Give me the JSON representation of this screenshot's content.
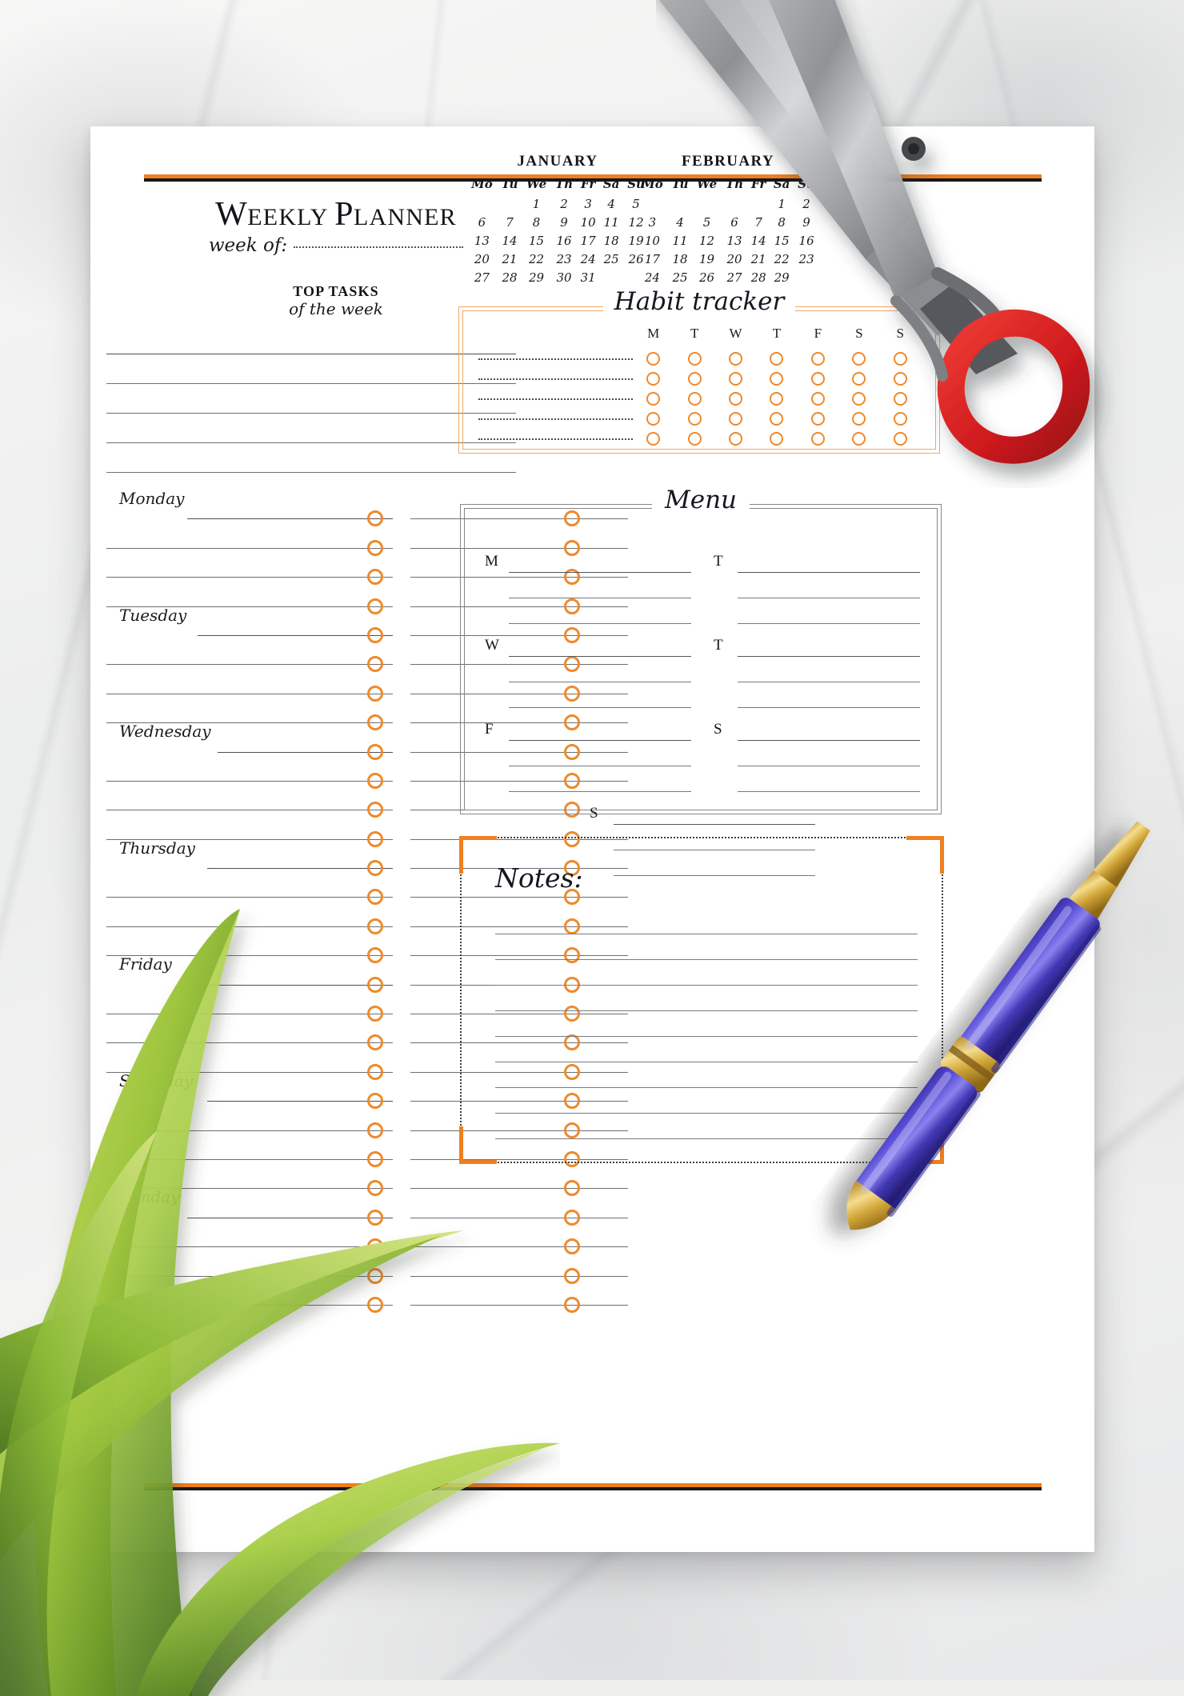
{
  "page": {
    "title_part1": "W",
    "title_part2": "EEKLY ",
    "title_part3": "P",
    "title_part4": "LANNER",
    "title_full": "Weekly Planner",
    "week_of_label": "week of:",
    "accent_orange": "#EF7F1F",
    "circle_orange": "#EE8A2C",
    "rule_black": "#19181A",
    "habit_border": "#F0A867"
  },
  "calendars": [
    {
      "name": "JANUARY",
      "weekday_headers": [
        "Mo",
        "Tu",
        "We",
        "Th",
        "Fr",
        "Sa",
        "Su"
      ],
      "weeks": [
        [
          "",
          "",
          "1",
          "2",
          "3",
          "4",
          "5"
        ],
        [
          "6",
          "7",
          "8",
          "9",
          "10",
          "11",
          "12"
        ],
        [
          "13",
          "14",
          "15",
          "16",
          "17",
          "18",
          "19"
        ],
        [
          "20",
          "21",
          "22",
          "23",
          "24",
          "25",
          "26"
        ],
        [
          "27",
          "28",
          "29",
          "30",
          "31",
          "",
          ""
        ]
      ]
    },
    {
      "name": "FEBRUARY",
      "weekday_headers": [
        "Mo",
        "Tu",
        "We",
        "Th",
        "Fr",
        "Sa",
        "Su"
      ],
      "weeks": [
        [
          "",
          "",
          "",
          "",
          "",
          "1",
          "2"
        ],
        [
          "3",
          "4",
          "5",
          "6",
          "7",
          "8",
          "9"
        ],
        [
          "10",
          "11",
          "12",
          "13",
          "14",
          "15",
          "16"
        ],
        [
          "17",
          "18",
          "19",
          "20",
          "21",
          "22",
          "23"
        ],
        [
          "24",
          "25",
          "26",
          "27",
          "28",
          "29",
          ""
        ]
      ]
    }
  ],
  "top_tasks": {
    "heading_line1": "TOP TASKS",
    "heading_line2": "of the week",
    "line_count": 5
  },
  "habit_tracker": {
    "title": "Habit tracker",
    "day_headers": [
      "M",
      "T",
      "W",
      "T",
      "F",
      "S",
      "S"
    ],
    "row_count": 5
  },
  "week_schedule": {
    "days": [
      "Monday",
      "Tuesday",
      "Wednesday",
      "Thursday",
      "Friday",
      "Saturday",
      "Sunday"
    ],
    "lines_per_day": 4
  },
  "menu": {
    "title": "Menu",
    "groups": [
      {
        "left_letter": "M",
        "right_letter": "T",
        "lines_per_cell": 3
      },
      {
        "left_letter": "W",
        "right_letter": "T",
        "lines_per_cell": 3
      },
      {
        "left_letter": "F",
        "right_letter": "S",
        "lines_per_cell": 3
      }
    ],
    "single": {
      "letter": "S",
      "lines": 3
    }
  },
  "notes": {
    "title": "Notes:",
    "line_count": 9
  }
}
